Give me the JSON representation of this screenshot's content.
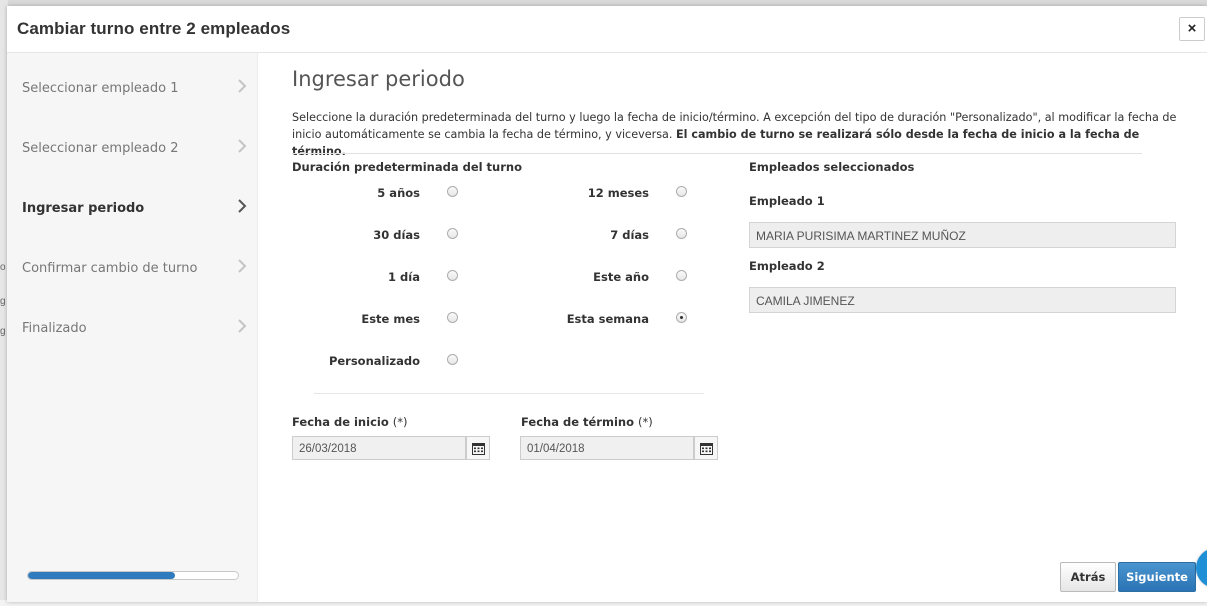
{
  "modal": {
    "title": "Cambiar turno entre 2 empleados",
    "close_label": "×"
  },
  "steps": [
    {
      "label": "Seleccionar empleado 1",
      "active": false
    },
    {
      "label": "Seleccionar empleado 2",
      "active": false
    },
    {
      "label": "Ingresar periodo",
      "active": true
    },
    {
      "label": "Confirmar cambio de turno",
      "active": false
    },
    {
      "label": "Finalizado",
      "active": false
    }
  ],
  "progress_percent": 70,
  "section": {
    "title": "Ingresar periodo",
    "intro_text": "Seleccione la duración predeterminada del turno y luego la fecha de inicio/término. A excepción del tipo de duración \"Personalizado\", al modificar la fecha de inicio automáticamente se cambia la fecha de término, y viceversa. ",
    "intro_bold": "El cambio de turno se realizará sólo desde la fecha de inicio a la fecha de término."
  },
  "duration": {
    "title": "Duración predeterminada del turno",
    "options": [
      {
        "label": "5 años",
        "checked": false
      },
      {
        "label": "12 meses",
        "checked": false
      },
      {
        "label": "30 días",
        "checked": false
      },
      {
        "label": "7 días",
        "checked": false
      },
      {
        "label": "1 día",
        "checked": false
      },
      {
        "label": "Este año",
        "checked": false
      },
      {
        "label": "Este mes",
        "checked": false
      },
      {
        "label": "Esta semana",
        "checked": true
      },
      {
        "label": "Personalizado",
        "checked": false
      }
    ]
  },
  "dates": {
    "start_label": "Fecha de inicio",
    "start_required": "(*)",
    "start_value": "26/03/2018",
    "end_label": "Fecha de término",
    "end_required": "(*)",
    "end_value": "01/04/2018"
  },
  "employees": {
    "title": "Empleados seleccionados",
    "emp1_label": "Empleado 1",
    "emp1_value": "MARIA PURISIMA MARTINEZ MUÑOZ",
    "emp2_label": "Empleado 2",
    "emp2_value": "CAMILA JIMENEZ"
  },
  "buttons": {
    "back_label": "Atrás",
    "next_label": "Siguiente"
  },
  "colors": {
    "accent": "#2a73b5",
    "progress": "#2f7bbd"
  }
}
